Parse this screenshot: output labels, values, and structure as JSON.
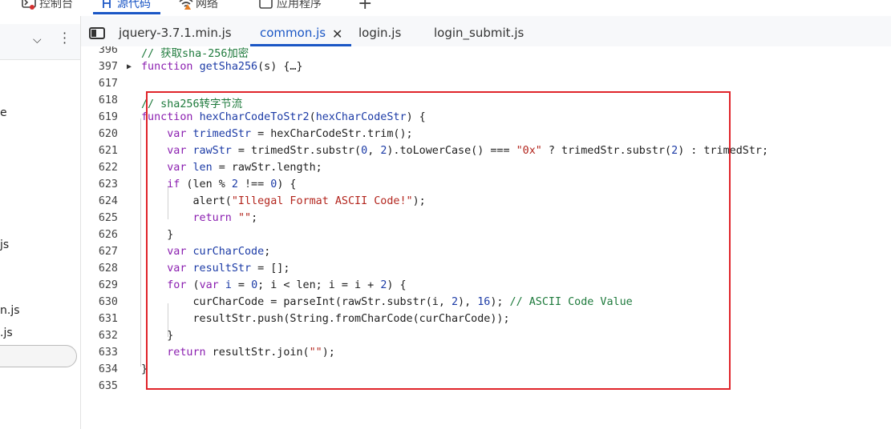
{
  "top_tabs": [
    {
      "label": "控制台",
      "icon": "console-icon"
    },
    {
      "label": "源代码",
      "icon": "sources-icon"
    },
    {
      "label": "网络",
      "icon": "network-wifi-icon"
    },
    {
      "label": "应用程序",
      "icon": "application-icon"
    }
  ],
  "sidebar": {
    "frag_e": "e",
    "frag_js1": "js",
    "frag_njs": "n.js",
    "frag_js2": ".js"
  },
  "file_tabs": [
    "jquery-3.7.1.min.js",
    "common.js",
    "login.js",
    "login_submit.js"
  ],
  "active_file": "common.js",
  "accent": "#1a56c5",
  "highlight_color": "#e0242a",
  "lines": [
    {
      "n": "396",
      "html": "<span class='cm'>// 获取sha-256加密</span>"
    },
    {
      "n": "397",
      "fold": "▶",
      "html": "<span class='kw'>function</span> <span class='fn'>getSha256</span>(s) {…}"
    },
    {
      "n": "617",
      "html": ""
    },
    {
      "n": "618",
      "html": "<span class='cm'>// sha256转字节流</span>"
    },
    {
      "n": "619",
      "html": "<span class='kw'>function</span> <span class='fn'>hexCharCodeToStr2</span>(<span class='fn'>hexCharCodeStr</span>) {"
    },
    {
      "n": "620",
      "html": "    <span class='kw'>var</span> <span class='fn'>trimedStr</span> = hexCharCodeStr.trim();"
    },
    {
      "n": "621",
      "html": "    <span class='kw'>var</span> <span class='fn'>rawStr</span> = trimedStr.substr(<span class='num'>0</span>, <span class='num'>2</span>).toLowerCase() === <span class='str'>\"0x\"</span> ? trimedStr.substr(<span class='num'>2</span>) : trimedStr;"
    },
    {
      "n": "622",
      "html": "    <span class='kw'>var</span> <span class='fn'>len</span> = rawStr.length;"
    },
    {
      "n": "623",
      "html": "    <span class='kw'>if</span> (len % <span class='num'>2</span> !== <span class='num'>0</span>) {"
    },
    {
      "n": "624",
      "html": "        alert(<span class='str'>\"Illegal Format ASCII Code!\"</span>);"
    },
    {
      "n": "625",
      "html": "        <span class='kw'>return</span> <span class='str'>\"\"</span>;"
    },
    {
      "n": "626",
      "html": "    }"
    },
    {
      "n": "627",
      "html": "    <span class='kw'>var</span> <span class='fn'>curCharCode</span>;"
    },
    {
      "n": "628",
      "html": "    <span class='kw'>var</span> <span class='fn'>resultStr</span> = [];"
    },
    {
      "n": "629",
      "html": "    <span class='kw'>for</span> (<span class='kw'>var</span> <span class='fn'>i</span> = <span class='num'>0</span>; i &lt; len; i = i + <span class='num'>2</span>) {"
    },
    {
      "n": "630",
      "html": "        curCharCode = parseInt(rawStr.substr(i, <span class='num'>2</span>), <span class='num'>16</span>); <span class='cm'>// ASCII Code Value</span>"
    },
    {
      "n": "631",
      "html": "        resultStr.push(String.fromCharCode(curCharCode));"
    },
    {
      "n": "632",
      "html": "    }"
    },
    {
      "n": "633",
      "html": "    <span class='kw'>return</span> resultStr.join(<span class='str'>\"\"</span>);"
    },
    {
      "n": "634",
      "html": "}"
    },
    {
      "n": "635",
      "html": ""
    }
  ]
}
